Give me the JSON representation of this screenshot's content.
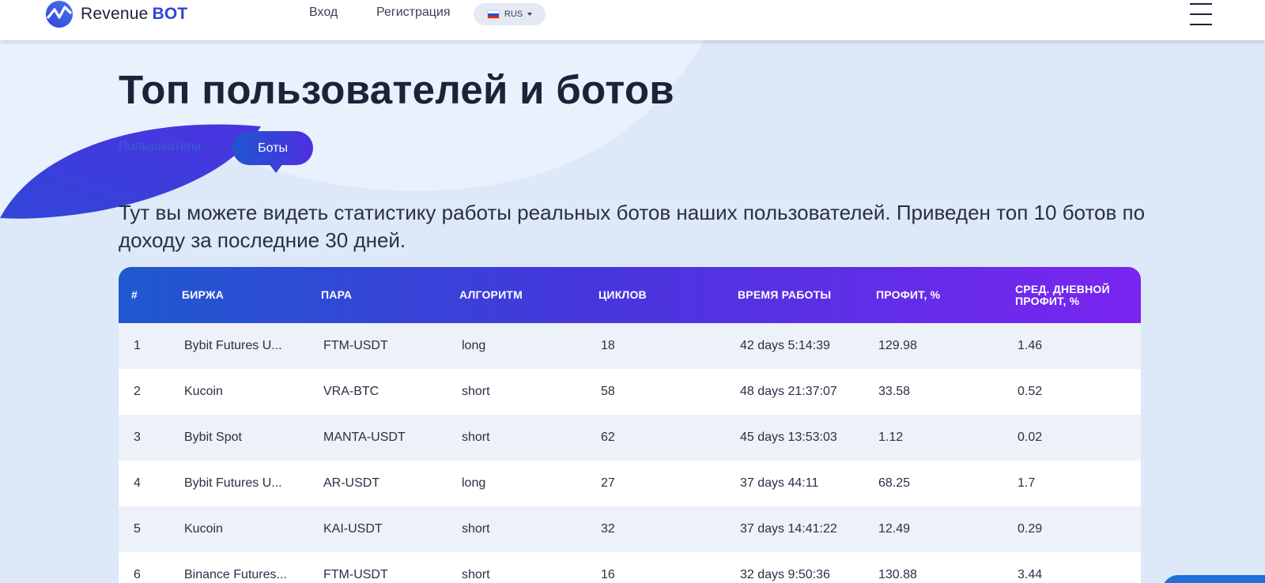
{
  "header": {
    "logo": {
      "brand": "Revenue",
      "brand_bold": "BOT"
    },
    "nav": {
      "login": "Вход",
      "register": "Регистрация"
    },
    "language": {
      "label": "RUS"
    }
  },
  "page": {
    "title": "Топ пользователей и ботов",
    "tabs": {
      "users": "Пользователи",
      "bots": "Боты"
    },
    "active_tab": "Боты",
    "description": "Тут вы можете видеть статистику работы реальных ботов наших пользователей. Приведен топ 10 ботов по доходу за последние 30 дней."
  },
  "table": {
    "headers": [
      "#",
      "БИРЖА",
      "ПАРА",
      "АЛГОРИТМ",
      "ЦИКЛОВ",
      "ВРЕМЯ РАБОТЫ",
      "ПРОФИТ, %",
      "СРЕД. ДНЕВНОЙ ПРОФИТ, %"
    ],
    "rows": [
      [
        "1",
        "Bybit Futures U...",
        "FTM-USDT",
        "long",
        "18",
        "42 days 5:14:39",
        "129.98",
        "1.46"
      ],
      [
        "2",
        "Kucoin",
        "VRA-BTC",
        "short",
        "58",
        "48 days 21:37:07",
        "33.58",
        "0.52"
      ],
      [
        "3",
        "Bybit Spot",
        "MANTA-USDT",
        "short",
        "62",
        "45 days 13:53:03",
        "1.12",
        "0.02"
      ],
      [
        "4",
        "Bybit Futures U...",
        "AR-USDT",
        "long",
        "27",
        "37 days 44:11",
        "68.25",
        "1.7"
      ],
      [
        "5",
        "Kucoin",
        "KAI-USDT",
        "short",
        "32",
        "37 days 14:41:22",
        "12.49",
        "0.29"
      ],
      [
        "6",
        "Binance Futures...",
        "FTM-USDT",
        "short",
        "16",
        "32 days 9:50:36",
        "130.88",
        "3.44"
      ]
    ]
  },
  "colors": {
    "accent_blue": "#1f56cf",
    "accent_purple": "#7a25f0",
    "background": "#dde8f9",
    "text_dark": "#1c2238"
  }
}
